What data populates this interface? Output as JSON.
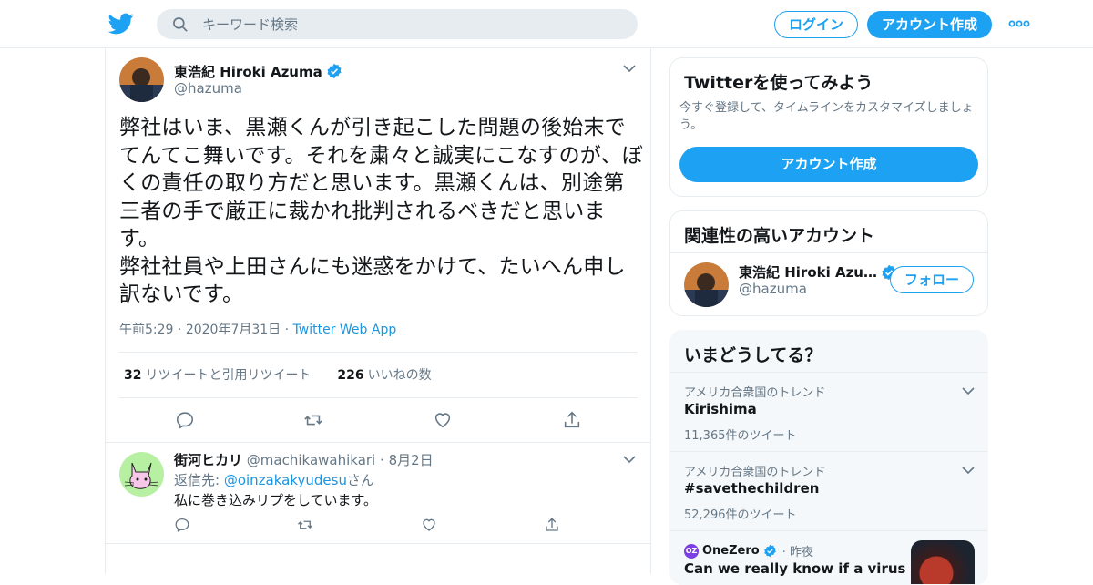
{
  "header": {
    "search_placeholder": "キーワード検索",
    "login_label": "ログイン",
    "signup_label": "アカウント作成"
  },
  "tweet": {
    "author_name": "東浩紀 Hiroki Azuma",
    "author_handle": "@hazuma",
    "text": "弊社はいま、黒瀬くんが引き起こした問題の後始末でてんてこ舞いです。それを粛々と誠実にこなすのが、ぼくの責任の取り方だと思います。黒瀬くんは、別途第三者の手で厳正に裁かれ批判されるべきだと思います。\n弊社社員や上田さんにも迷惑をかけて、たいへん申し訳ないです。",
    "time": "午前5:29",
    "date": "2020年7月31日",
    "app": "Twitter Web App",
    "retweet_count": "32",
    "retweet_label": "リツイートと引用リツイート",
    "like_count": "226",
    "like_label": "いいねの数"
  },
  "reply": {
    "author_name": "街河ヒカリ",
    "author_handle": "@machikawahikari",
    "date": "8月2日",
    "reply_to_prefix": "返信先: ",
    "reply_to_handle": "@oinzakakyudesu",
    "reply_to_suffix": "さん",
    "text": "私に巻き込みリプをしています。"
  },
  "sidebar": {
    "signup_card": {
      "title": "Twitterを使ってみよう",
      "description": "今すぐ登録して、タイムラインをカスタマイズしましょう。",
      "button_label": "アカウント作成"
    },
    "related_card": {
      "title": "関連性の高いアカウント",
      "account_name": "東浩紀 Hiroki Azu…",
      "account_handle": "@hazuma",
      "follow_label": "フォロー"
    },
    "trends_card": {
      "title": "いまどうしてる？",
      "trends": [
        {
          "location": "アメリカ合衆国のトレンド",
          "topic": "Kirishima",
          "count": "11,365件のツイート"
        },
        {
          "location": "アメリカ合衆国のトレンド",
          "topic": "#savethechildren",
          "count": "52,296件のツイート"
        }
      ],
      "news": {
        "source": "OneZero",
        "source_badge": "OZ",
        "time": "昨夜",
        "headline": "Can we really know if a virus was"
      }
    }
  },
  "colors": {
    "accent": "#1da1f2",
    "link": "#1b95e0",
    "muted": "#657786",
    "border": "#e6ecf0"
  }
}
